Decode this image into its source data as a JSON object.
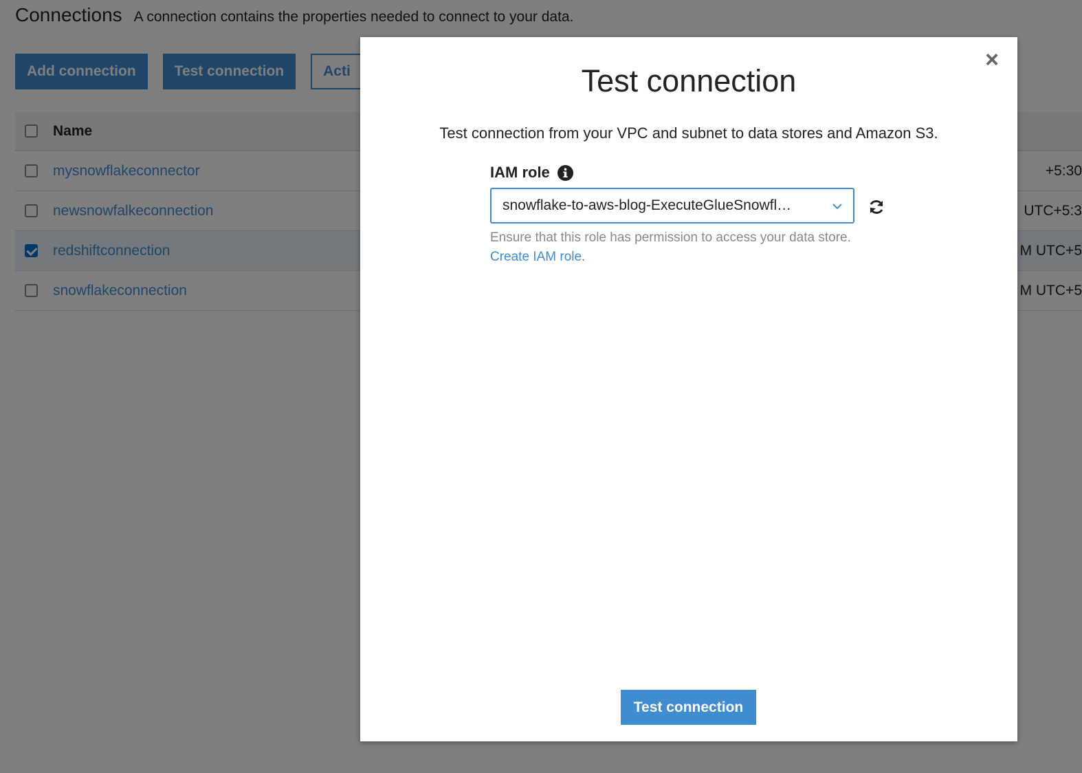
{
  "page": {
    "title": "Connections",
    "description": "A connection contains the properties needed to connect to your data."
  },
  "toolbar": {
    "add_label": "Add connection",
    "test_label": "Test connection",
    "actions_label": "Acti"
  },
  "table": {
    "header_name": "Name",
    "rows": [
      {
        "name": "mysnowflakeconnector",
        "tail": "+5:30",
        "checked": false
      },
      {
        "name": "newsnowfalkeconnection",
        "tail": "UTC+5:3",
        "checked": false
      },
      {
        "name": "redshiftconnection",
        "tail": "M UTC+5",
        "checked": true
      },
      {
        "name": "snowflakeconnection",
        "tail": "M UTC+5",
        "checked": false
      }
    ]
  },
  "modal": {
    "title": "Test connection",
    "description": "Test connection from your VPC and subnet to data stores and Amazon S3.",
    "iam_label": "IAM role",
    "iam_value": "snowflake-to-aws-blog-ExecuteGlueSnowfl…",
    "hint": "Ensure that this role has permission to access your data store.",
    "create_link": "Create IAM role.",
    "submit_label": "Test connection",
    "close_symbol": "×"
  },
  "icons": {
    "info": "info-icon",
    "chevron": "chevron-down-icon",
    "refresh": "refresh-icon",
    "close": "close-icon"
  },
  "colors": {
    "accent": "#3f8cd0",
    "overlay": "rgba(0,0,0,0.5)"
  }
}
